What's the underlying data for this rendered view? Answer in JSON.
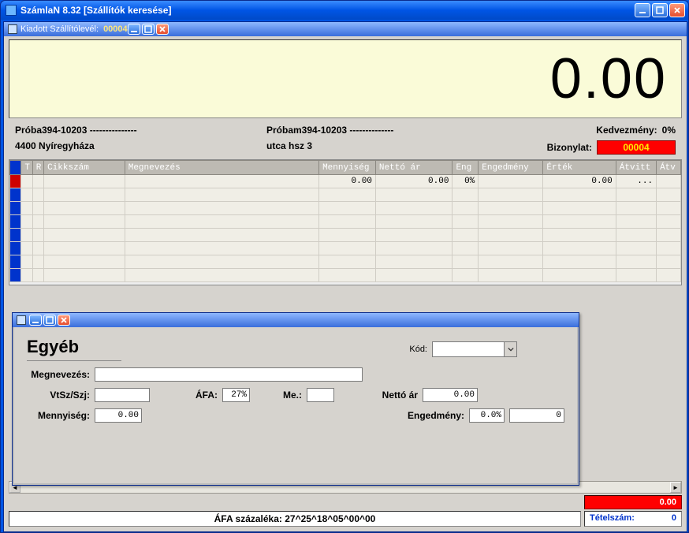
{
  "outer": {
    "title": "SzámlaN 8.32   [Szállítók keresése]"
  },
  "child": {
    "title_label": "Kiadott Szállítólevél:",
    "title_number": "00004"
  },
  "display": {
    "value": "0.00"
  },
  "header": {
    "name": "Próba394-10203 ---------------",
    "city": "4400 Nyíregyháza",
    "name2": "Próbam394-10203 --------------",
    "address": "utca hsz 3",
    "kedvezmeny_label": "Kedvezmény:",
    "kedvezmeny_value": "0%",
    "bizonylat_label": "Bizonylat:",
    "bizonylat_value": "00004"
  },
  "grid": {
    "cols": {
      "t": "T",
      "r": "R",
      "cikk": "Cikkszám",
      "megn": "Megnevezés",
      "menny": "Mennyiség",
      "netto": "Nettó ár",
      "eng": "Eng",
      "enged": "Engedmény",
      "ertek": "Érték",
      "atvitt": "Átvitt",
      "atv2": "Átv"
    },
    "row1": {
      "menny": "0.00",
      "netto": "0.00",
      "eng": "0%",
      "ertek": "0.00",
      "atvitt": "..."
    }
  },
  "dialog": {
    "title": "Egyéb",
    "kod_label": "Kód:",
    "kod_value": "",
    "megnevezes_label": "Megnevezés:",
    "megnevezes_value": "",
    "vtsz_label": "VtSz/Szj:",
    "vtsz_value": "",
    "afa_label": "ÁFA:",
    "afa_value": "27%",
    "me_label": "Me.:",
    "me_value": "",
    "netto_label": "Nettó ár",
    "netto_value": "0.00",
    "menny_label": "Mennyiség:",
    "menny_value": "0.00",
    "enged_label": "Engedmény:",
    "enged_pct": "0.0%",
    "enged_val": "0"
  },
  "bottom": {
    "red_total": "0.00",
    "afa_status": "ÁFA százaléka: 27^25^18^05^00^00",
    "tetelszam_label": "Tételszám:",
    "tetelszam_value": "0"
  }
}
